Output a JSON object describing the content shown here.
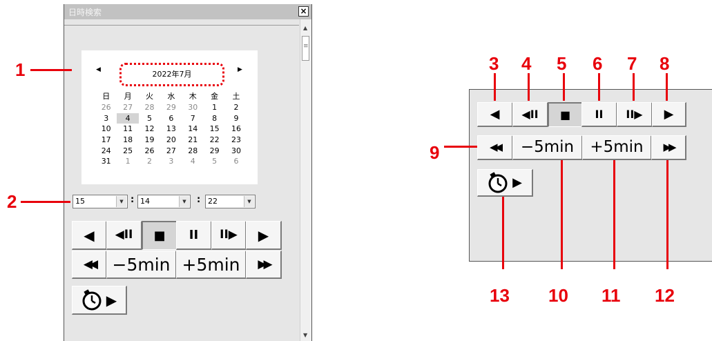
{
  "window": {
    "title": "日時検索",
    "close_label": "×"
  },
  "calendar": {
    "prev": "◀",
    "next": "▶",
    "month_label": "2022年7月",
    "days": [
      "日",
      "月",
      "火",
      "水",
      "木",
      "金",
      "土"
    ],
    "weeks": [
      [
        {
          "d": "26",
          "o": true
        },
        {
          "d": "27",
          "o": true
        },
        {
          "d": "28",
          "o": true
        },
        {
          "d": "29",
          "o": true
        },
        {
          "d": "30",
          "o": true
        },
        {
          "d": "1"
        },
        {
          "d": "2"
        }
      ],
      [
        {
          "d": "3"
        },
        {
          "d": "4",
          "s": true
        },
        {
          "d": "5"
        },
        {
          "d": "6"
        },
        {
          "d": "7"
        },
        {
          "d": "8"
        },
        {
          "d": "9"
        }
      ],
      [
        {
          "d": "10"
        },
        {
          "d": "11"
        },
        {
          "d": "12"
        },
        {
          "d": "13"
        },
        {
          "d": "14"
        },
        {
          "d": "15"
        },
        {
          "d": "16"
        }
      ],
      [
        {
          "d": "17"
        },
        {
          "d": "18"
        },
        {
          "d": "19"
        },
        {
          "d": "20"
        },
        {
          "d": "21"
        },
        {
          "d": "22"
        },
        {
          "d": "23"
        }
      ],
      [
        {
          "d": "24"
        },
        {
          "d": "25"
        },
        {
          "d": "26"
        },
        {
          "d": "27"
        },
        {
          "d": "28"
        },
        {
          "d": "29"
        },
        {
          "d": "30"
        }
      ],
      [
        {
          "d": "31"
        },
        {
          "d": "1",
          "o": true
        },
        {
          "d": "2",
          "o": true
        },
        {
          "d": "3",
          "o": true
        },
        {
          "d": "4",
          "o": true
        },
        {
          "d": "5",
          "o": true
        },
        {
          "d": "6",
          "o": true
        }
      ]
    ]
  },
  "time": {
    "hour": "15",
    "minute": "14",
    "second": "22",
    "separator": ":",
    "dropdown_arrow": "▼"
  },
  "controls": {
    "reverse_play": "◀",
    "step_back": "◀II",
    "stop": "■",
    "pause": "II",
    "step_forward": "II▶",
    "play": "▶",
    "fast_rewind": "◀◀",
    "minus_5min": "−5min",
    "plus_5min": "+5min",
    "fast_forward": "▶▶",
    "timer_play": "▶",
    "pressed": "stop"
  },
  "callouts": [
    "1",
    "2",
    "3",
    "4",
    "5",
    "6",
    "7",
    "8",
    "9",
    "10",
    "11",
    "12",
    "13"
  ],
  "colors": {
    "callout": "#e8000b",
    "panel": "#e6e6e6"
  }
}
